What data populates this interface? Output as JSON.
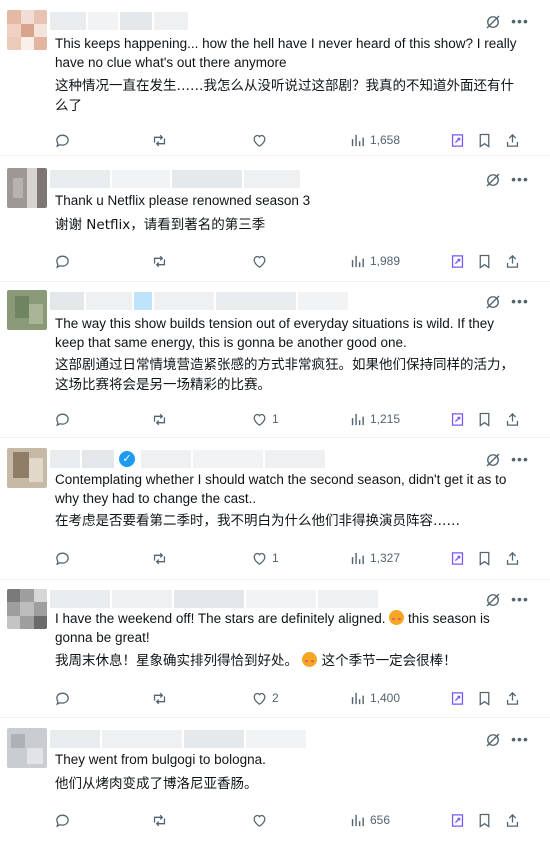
{
  "posts": [
    {
      "text_en": "This keeps happening... how the hell have I never heard of this show? I really have no clue what's out there anymore",
      "text_zh": "这种情况一直在发生……我怎么从没听说过这部剧？我真的不知道外面还有什么了",
      "replies": "",
      "reposts": "",
      "likes": "",
      "views": "1,658"
    },
    {
      "text_en": "Thank u Netflix please renowned season 3",
      "text_zh": "谢谢 Netflix，请看到著名的第三季",
      "replies": "",
      "reposts": "",
      "likes": "",
      "views": "1,989"
    },
    {
      "text_en": "The way this show builds tension out of everyday situations is wild. If they keep that same energy, this is gonna be another good one.",
      "text_zh": "这部剧通过日常情境营造紧张感的方式非常疯狂。如果他们保持同样的活力，这场比赛将会是另一场精彩的比赛。",
      "replies": "",
      "reposts": "",
      "likes": "1",
      "views": "1,215"
    },
    {
      "text_en": "Contemplating whether I should watch the second season, didn't get it as to why they had to change the cast..",
      "text_zh": "在考虑是否要看第二季时，我不明白为什么他们非得换演员阵容……",
      "replies": "",
      "reposts": "",
      "likes": "1",
      "views": "1,327"
    },
    {
      "text_en_1": "I have the weekend off! The stars are definitely aligned.",
      "text_en_2": "this season is gonna be great!",
      "text_zh_1": "我周末休息！星象确实排列得恰到好处。",
      "text_zh_2": "这个季节一定会很棒！",
      "replies": "",
      "reposts": "",
      "likes": "2",
      "views": "1,400"
    },
    {
      "text_en": "They went from bulgogi to bologna.",
      "text_zh": "他们从烤肉变成了博洛尼亚香肠。",
      "replies": "",
      "reposts": "",
      "likes": "",
      "views": "656"
    }
  ],
  "icons": {
    "grok": "grok-icon",
    "more": "more-icon",
    "reply": "reply-icon",
    "repost": "repost-icon",
    "like": "heart-icon",
    "views": "views-icon",
    "grok_action": "grok-action-icon",
    "bookmark": "bookmark-icon",
    "share": "share-icon",
    "verified": "verified-badge-icon"
  },
  "colors": {
    "text": "#0f1419",
    "secondary": "#536471",
    "accent": "#7856ff",
    "verified": "#1d9bf0",
    "divider": "#eff3f4"
  }
}
